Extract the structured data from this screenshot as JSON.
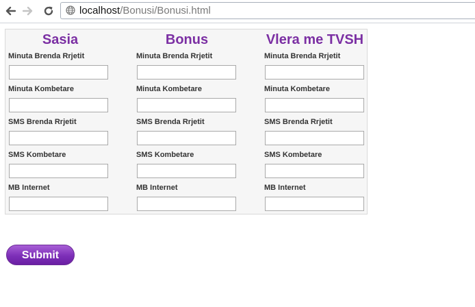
{
  "browser": {
    "url_host": "localhost",
    "url_path": "/Bonusi/Bonusi.html"
  },
  "columns": [
    {
      "header": "Sasia",
      "fields": [
        {
          "label": "Minuta Brenda Rrjetit",
          "value": ""
        },
        {
          "label": "Minuta Kombetare",
          "value": ""
        },
        {
          "label": "SMS Brenda Rrjetit",
          "value": ""
        },
        {
          "label": "SMS Kombetare",
          "value": ""
        },
        {
          "label": "MB Internet",
          "value": ""
        }
      ]
    },
    {
      "header": "Bonus",
      "fields": [
        {
          "label": "Minuta Brenda Rrjetit",
          "value": ""
        },
        {
          "label": "Minuta Kombetare",
          "value": ""
        },
        {
          "label": "SMS Brenda Rrjetit",
          "value": ""
        },
        {
          "label": "SMS Kombetare",
          "value": ""
        },
        {
          "label": "MB Internet",
          "value": ""
        }
      ]
    },
    {
      "header": "Vlera me TVSH",
      "fields": [
        {
          "label": "Minuta Brenda Rrjetit",
          "value": ""
        },
        {
          "label": "Minuta Kombetare",
          "value": ""
        },
        {
          "label": "SMS Brenda Rrjetit",
          "value": ""
        },
        {
          "label": "SMS Kombetare",
          "value": ""
        },
        {
          "label": "MB Internet",
          "value": ""
        }
      ]
    }
  ],
  "submit_label": "Submit",
  "colors": {
    "header": "#7b2fa3",
    "button": "#7d2fb8"
  }
}
